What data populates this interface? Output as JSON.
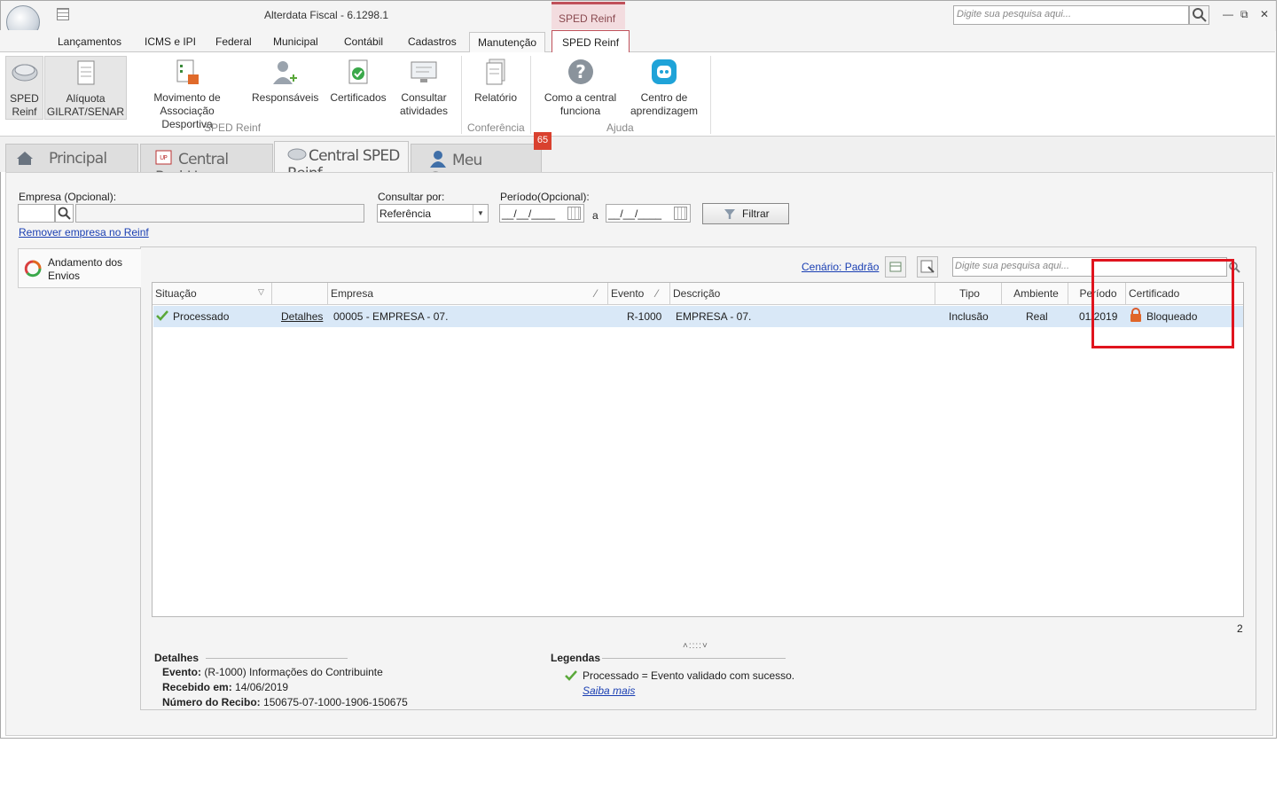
{
  "app": {
    "title": "Alterdata Fiscal - 6.1298.1",
    "context_tab": "SPED Reinf",
    "search_placeholder": "Digite sua pesquisa aqui..."
  },
  "menu": {
    "tabs": [
      "Lançamentos",
      "ICMS e IPI",
      "Federal",
      "Municipal",
      "Contábil",
      "Cadastros",
      "Manutenção",
      "SPED Reinf"
    ]
  },
  "ribbon": {
    "buttons": [
      {
        "label1": "SPED",
        "label2": "Reinf"
      },
      {
        "label1": "Alíquota",
        "label2": "GILRAT/SENAR"
      },
      {
        "label1": "Movimento de",
        "label2": "Associação Desportiva"
      },
      {
        "label1": "Responsáveis",
        "label2": ""
      },
      {
        "label1": "Certificados",
        "label2": ""
      },
      {
        "label1": "Consultar",
        "label2": "atividades"
      },
      {
        "label1": "Relatório",
        "label2": ""
      },
      {
        "label1": "Como a central",
        "label2": "funciona"
      },
      {
        "label1": "Centro de",
        "label2": "aprendizagem"
      }
    ],
    "groups": [
      "SPED Reinf",
      "Conferência",
      "Ajuda"
    ]
  },
  "doctabs": [
    "Principal",
    "Central PackUp",
    "Central SPED Reinf",
    "Meu Gerente"
  ],
  "badge": "65",
  "filters": {
    "empresa_label": "Empresa (Opcional):",
    "remover_link": "Remover empresa no Reinf",
    "consultar_label": "Consultar por:",
    "consultar_value": "Referência",
    "periodo_label": "Período(Opcional):",
    "date_from": "__/__/____",
    "date_sep": "a",
    "date_to": "__/__/____",
    "filtrar": "Filtrar"
  },
  "side": {
    "item": "Andamento dos",
    "item2": "Envios"
  },
  "toolbar": {
    "cenario": "Cenário: Padrão",
    "search_placeholder": "Digite sua pesquisa aqui..."
  },
  "grid": {
    "headers": [
      "Situação",
      "",
      "Empresa",
      "Evento",
      "Descrição",
      "Tipo",
      "Ambiente",
      "Período",
      "Certificado"
    ],
    "rows": [
      {
        "situacao": "Processado",
        "detalhes": "Detalhes",
        "empresa": "00005 - EMPRESA - 07.",
        "evento": "R-1000",
        "descricao": "EMPRESA - 07.",
        "tipo": "Inclusão",
        "ambiente": "Real",
        "periodo": "01/2019",
        "certificado": "Bloqueado"
      }
    ],
    "count": "2"
  },
  "details": {
    "title": "Detalhes",
    "evento_label": "Evento:",
    "evento": "(R-1000) Informações do Contribuinte",
    "recebido_label": "Recebido em:",
    "recebido": "14/06/2019",
    "recibo_label": "Número do Recibo:",
    "recibo": "150675-07-1000-1906-150675"
  },
  "legend": {
    "title": "Legendas",
    "item": "Processado = Evento validado com sucesso.",
    "link": "Saiba mais"
  },
  "colors": {
    "accent": "#c0505a",
    "highlight": "#e0141e",
    "selection": "#d9e8f7"
  }
}
